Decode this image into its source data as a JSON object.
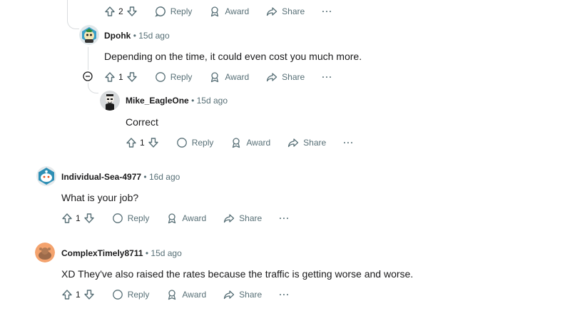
{
  "actions": {
    "reply_label": "Reply",
    "award_label": "Award",
    "share_label": "Share",
    "more_label": "···"
  },
  "comments": [
    {
      "vote_count": "2"
    },
    {
      "author": "Dpohk",
      "separator": "•",
      "time": "15d ago",
      "body": "Depending on the time, it could even cost you much more.",
      "vote_count": "1"
    },
    {
      "author": "Mike_EagleOne",
      "separator": "•",
      "time": "15d ago",
      "body": "Correct",
      "vote_count": "1"
    },
    {
      "author": "Individual-Sea-4977",
      "separator": "•",
      "time": "16d ago",
      "body": "What is your job?",
      "vote_count": "1"
    },
    {
      "author": "ComplexTimely8711",
      "separator": "•",
      "time": "15d ago",
      "body": "XD They've also raised the rates because the traffic is getting worse and worse.",
      "vote_count": "1"
    }
  ],
  "colors": {
    "meta_gray": "#576f76",
    "thread_line": "#d9dcde",
    "text": "#1a1a1b"
  }
}
